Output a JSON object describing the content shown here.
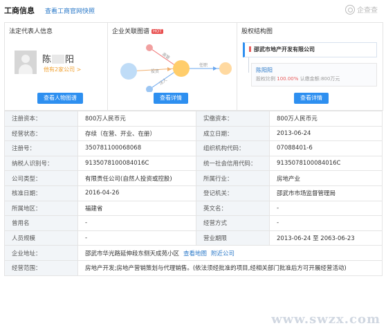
{
  "header": {
    "title": "工商信息",
    "snapshot_link": "查看工商官网快照",
    "brand": "企查查"
  },
  "cards": {
    "legal_rep": {
      "title": "法定代表人信息",
      "name_a": "陈",
      "name_b": "阳",
      "sub": "他有2家公司 >",
      "button": "查看人物图谱"
    },
    "relation": {
      "title": "企业关联图谱",
      "badge": "HOT",
      "edge_labels": [
        "投资",
        "高管",
        "法人",
        "任职"
      ],
      "button": "查看详情"
    },
    "equity": {
      "title": "股权结构图",
      "company": "邵武市地产开发有限公司",
      "person": "陈阳阳",
      "detail_prefix": "股权比例",
      "detail_ratio": "100.00%",
      "detail_suffix": "认缴金额:800万元",
      "button": "查看详情"
    }
  },
  "table": [
    [
      "注册资本：",
      "800万人民币元",
      "实缴资本：",
      "800万人民币元"
    ],
    [
      "经营状态：",
      "存续（在营、开业、在册）",
      "成立日期：",
      "2013-06-24"
    ],
    [
      "注册号：",
      "350781100068068",
      "组织机构代码：",
      "07088401-6"
    ],
    [
      "纳税人识别号：",
      "9135078100084016C",
      "统一社会信用代码：",
      "9135078100084016C"
    ],
    [
      "公司类型：",
      "有限责任公司(自然人投资或控股)",
      "所属行业：",
      "房地产业"
    ],
    [
      "核准日期：",
      "2016-04-26",
      "登记机关：",
      "邵武市市场监督管理局"
    ],
    [
      "所属地区：",
      "福建省",
      "英文名：",
      "-"
    ],
    [
      "曾用名",
      "-",
      "经营方式",
      "-"
    ],
    [
      "人员规模",
      "-",
      "营业期限",
      "2013-06-24 至 2063-06-23"
    ]
  ],
  "address": {
    "label": "企业地址：",
    "value": "邵武市华光路延伸段东侧天成苑小区",
    "map_link": "查看地图",
    "nearby_link": "附近公司"
  },
  "scope": {
    "label": "经营范围：",
    "value": "房地产开发;房地产营销策划与代理销售。(依法须经批准的项目,经相关部门批准后方可开展经营活动)"
  },
  "watermark": "www.swzx.com",
  "colors": {
    "accent": "#2d8ff0",
    "link": "#2a78c8",
    "hot": "#e84f4f",
    "key_bg": "#f2f5f8"
  }
}
